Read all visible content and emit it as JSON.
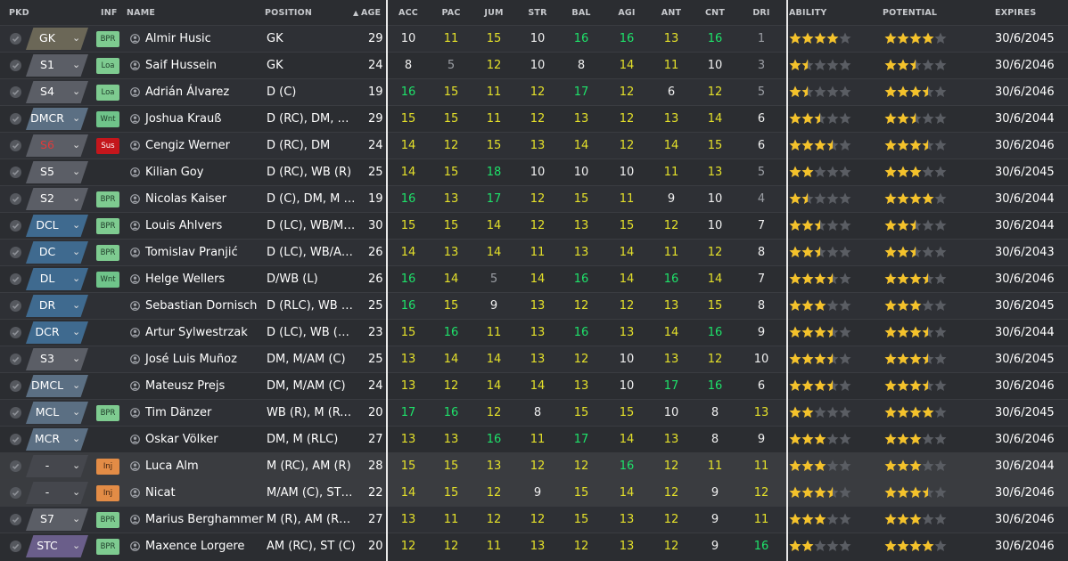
{
  "colors": {
    "attr_low": "#9b9ea4",
    "attr_mid": "#f0f0f0",
    "attr_good": "#e4e02a",
    "attr_high": "#1ee26a",
    "star_on": "#f4c22b",
    "star_off": "#5a5d63",
    "pos_gk": "#6a665a",
    "pos_sub": "#5b5e66",
    "pos_def": "#3f6a8f",
    "pos_mid": "#5b6f83",
    "pos_dash": "#4a4c52",
    "inf_bpr": "#7ecb90",
    "inf_wnt": "#6fc48a",
    "inf_sus": "#c4161c",
    "inf_inj": "#e38c46"
  },
  "headers": {
    "pkd": "PKD",
    "inf": "INF",
    "name": "NAME",
    "position": "POSITION",
    "age": "AGE",
    "acc": "ACC",
    "pac": "PAC",
    "jum": "JUM",
    "str": "STR",
    "bal": "BAL",
    "agi": "AGI",
    "ant": "ANT",
    "cnt": "CNT",
    "dri": "DRI",
    "ability": "ABILITY",
    "potential": "POTENTIAL",
    "expires": "EXPIRES"
  },
  "players": [
    {
      "pkd": "GK",
      "pkd_color": "#6b6757",
      "inf": "BPR",
      "inf_type": "bpr",
      "name": "Almir Husic",
      "position": "GK",
      "age": "29",
      "attrs": [
        10,
        11,
        15,
        10,
        16,
        16,
        13,
        16,
        1
      ],
      "ability": 4,
      "potential": 4,
      "expires": "30/6/2045"
    },
    {
      "pkd": "S1",
      "pkd_color": "#5b5e66",
      "inf": "Loa",
      "inf_type": "bpr",
      "name": "Saif Hussein",
      "position": "GK",
      "age": "24",
      "attrs": [
        8,
        5,
        12,
        10,
        8,
        14,
        11,
        10,
        3
      ],
      "ability": 1.5,
      "potential": 2.5,
      "expires": "30/6/2046"
    },
    {
      "pkd": "S4",
      "pkd_color": "#5b5e66",
      "inf": "Loa",
      "inf_type": "bpr",
      "name": "Adrián Álvarez",
      "position": "D (C)",
      "age": "19",
      "attrs": [
        16,
        15,
        11,
        12,
        17,
        12,
        6,
        12,
        5
      ],
      "ability": 1.5,
      "potential": 3.5,
      "expires": "30/6/2046"
    },
    {
      "pkd": "DMCR",
      "pkd_color": "#5b6f83",
      "inf": "Wnt",
      "inf_type": "wnt",
      "name": "Joshua Krauß",
      "position": "D (RC), DM, M (...",
      "age": "29",
      "attrs": [
        15,
        15,
        11,
        12,
        13,
        12,
        13,
        14,
        6
      ],
      "ability": 2.5,
      "potential": 2.5,
      "expires": "30/6/2044"
    },
    {
      "pkd": "S6",
      "pkd_color": "#5b5e66",
      "pkd_text_color": "#e03a3a",
      "inf": "Sus",
      "inf_type": "sus",
      "name": "Cengiz Werner",
      "position": "D (RC), DM",
      "age": "24",
      "attrs": [
        14,
        12,
        15,
        13,
        14,
        12,
        14,
        15,
        6
      ],
      "ability": 3.5,
      "potential": 3.5,
      "expires": "30/6/2046"
    },
    {
      "pkd": "S5",
      "pkd_color": "#5b5e66",
      "inf": "",
      "inf_type": "",
      "name": "Kilian Goy",
      "position": "D (RC), WB (R)",
      "age": "25",
      "attrs": [
        14,
        15,
        18,
        10,
        10,
        10,
        11,
        13,
        5
      ],
      "ability": 2,
      "potential": 3,
      "expires": "30/6/2045"
    },
    {
      "pkd": "S2",
      "pkd_color": "#5b5e66",
      "inf": "BPR",
      "inf_type": "bpr",
      "name": "Nicolas Kaiser",
      "position": "D (C), DM, M (C)",
      "age": "19",
      "attrs": [
        16,
        13,
        17,
        12,
        15,
        11,
        9,
        10,
        4
      ],
      "ability": 1.5,
      "potential": 4,
      "expires": "30/6/2044"
    },
    {
      "pkd": "DCL",
      "pkd_color": "#3f6a8f",
      "inf": "BPR",
      "inf_type": "bpr",
      "name": "Louis Ahlvers",
      "position": "D (LC), WB/M (L)",
      "age": "30",
      "attrs": [
        15,
        15,
        14,
        12,
        13,
        15,
        12,
        10,
        7
      ],
      "ability": 2.5,
      "potential": 2.5,
      "expires": "30/6/2044"
    },
    {
      "pkd": "DC",
      "pkd_color": "#3f6a8f",
      "inf": "BPR",
      "inf_type": "bpr",
      "name": "Tomislav Pranjić",
      "position": "D (LC), WB/AM...",
      "age": "26",
      "attrs": [
        14,
        13,
        14,
        11,
        13,
        14,
        11,
        12,
        8
      ],
      "ability": 2.5,
      "potential": 2.5,
      "expires": "30/6/2043"
    },
    {
      "pkd": "DL",
      "pkd_color": "#3f6a8f",
      "inf": "Wnt",
      "inf_type": "wnt",
      "name": "Helge Wellers",
      "position": "D/WB (L)",
      "age": "26",
      "attrs": [
        16,
        14,
        5,
        14,
        16,
        14,
        16,
        14,
        7
      ],
      "ability": 3.5,
      "potential": 3.5,
      "expires": "30/6/2046"
    },
    {
      "pkd": "DR",
      "pkd_color": "#3f6a8f",
      "inf": "",
      "inf_type": "",
      "name": "Sebastian Dornisch",
      "position": "D (RLC), WB (R)",
      "age": "25",
      "attrs": [
        16,
        15,
        9,
        13,
        12,
        12,
        13,
        15,
        8
      ],
      "ability": 3,
      "potential": 3,
      "expires": "30/6/2045"
    },
    {
      "pkd": "DCR",
      "pkd_color": "#3f6a8f",
      "inf": "",
      "inf_type": "",
      "name": "Artur Sylwestrzak",
      "position": "D (LC), WB (R),...",
      "age": "23",
      "attrs": [
        15,
        16,
        11,
        13,
        16,
        13,
        14,
        16,
        9
      ],
      "ability": 3.5,
      "potential": 3.5,
      "expires": "30/6/2044"
    },
    {
      "pkd": "S3",
      "pkd_color": "#5b5e66",
      "inf": "",
      "inf_type": "",
      "name": "José Luis Muñoz",
      "position": "DM, M/AM (C)",
      "age": "25",
      "attrs": [
        13,
        14,
        14,
        13,
        12,
        10,
        13,
        12,
        10
      ],
      "ability": 3.5,
      "potential": 3.5,
      "expires": "30/6/2045"
    },
    {
      "pkd": "DMCL",
      "pkd_color": "#5b6f83",
      "inf": "",
      "inf_type": "",
      "name": "Mateusz Prejs",
      "position": "DM, M/AM (C)",
      "age": "24",
      "attrs": [
        13,
        12,
        14,
        14,
        13,
        10,
        17,
        16,
        6
      ],
      "ability": 3.5,
      "potential": 3.5,
      "expires": "30/6/2046"
    },
    {
      "pkd": "MCL",
      "pkd_color": "#5b6f83",
      "inf": "BPR",
      "inf_type": "bpr",
      "name": "Tim Dänzer",
      "position": "WB (R), M (RC),...",
      "age": "20",
      "attrs": [
        17,
        16,
        12,
        8,
        15,
        15,
        10,
        8,
        13
      ],
      "ability": 2,
      "potential": 4,
      "expires": "30/6/2045"
    },
    {
      "pkd": "MCR",
      "pkd_color": "#5b6f83",
      "inf": "",
      "inf_type": "",
      "name": "Oskar Völker",
      "position": "DM, M (RLC)",
      "age": "27",
      "attrs": [
        13,
        13,
        16,
        11,
        17,
        14,
        13,
        8,
        9
      ],
      "ability": 3,
      "potential": 3,
      "expires": "30/6/2046"
    },
    {
      "pkd": "-",
      "pkd_color": "#45474d",
      "inf": "Inj",
      "inf_type": "inj",
      "name": "Luca Alm",
      "position": "M (RC), AM (R)",
      "age": "28",
      "attrs": [
        15,
        15,
        13,
        12,
        12,
        16,
        12,
        11,
        11
      ],
      "ability": 3,
      "potential": 3,
      "expires": "30/6/2044",
      "hl": true
    },
    {
      "pkd": "-",
      "pkd_color": "#45474d",
      "inf": "Inj",
      "inf_type": "inj",
      "name": "Nicat",
      "position": "M/AM (C), ST (C)",
      "age": "22",
      "attrs": [
        14,
        15,
        12,
        9,
        15,
        14,
        12,
        9,
        12
      ],
      "ability": 3.5,
      "potential": 3.5,
      "expires": "30/6/2046",
      "hl": true
    },
    {
      "pkd": "S7",
      "pkd_color": "#5b5e66",
      "inf": "BPR",
      "inf_type": "bpr",
      "name": "Marius Berghammer",
      "position": "M (R), AM (RLC)...",
      "age": "27",
      "attrs": [
        13,
        11,
        12,
        12,
        15,
        13,
        12,
        9,
        11
      ],
      "ability": 3,
      "potential": 3,
      "expires": "30/6/2046"
    },
    {
      "pkd": "STC",
      "pkd_color": "#6a5e8a",
      "inf": "BPR",
      "inf_type": "bpr",
      "name": "Maxence Lorgere",
      "position": "AM (RC), ST (C)",
      "age": "20",
      "attrs": [
        12,
        12,
        11,
        13,
        12,
        13,
        12,
        9,
        16
      ],
      "ability": 2,
      "potential": 4,
      "expires": "30/6/2046"
    }
  ]
}
